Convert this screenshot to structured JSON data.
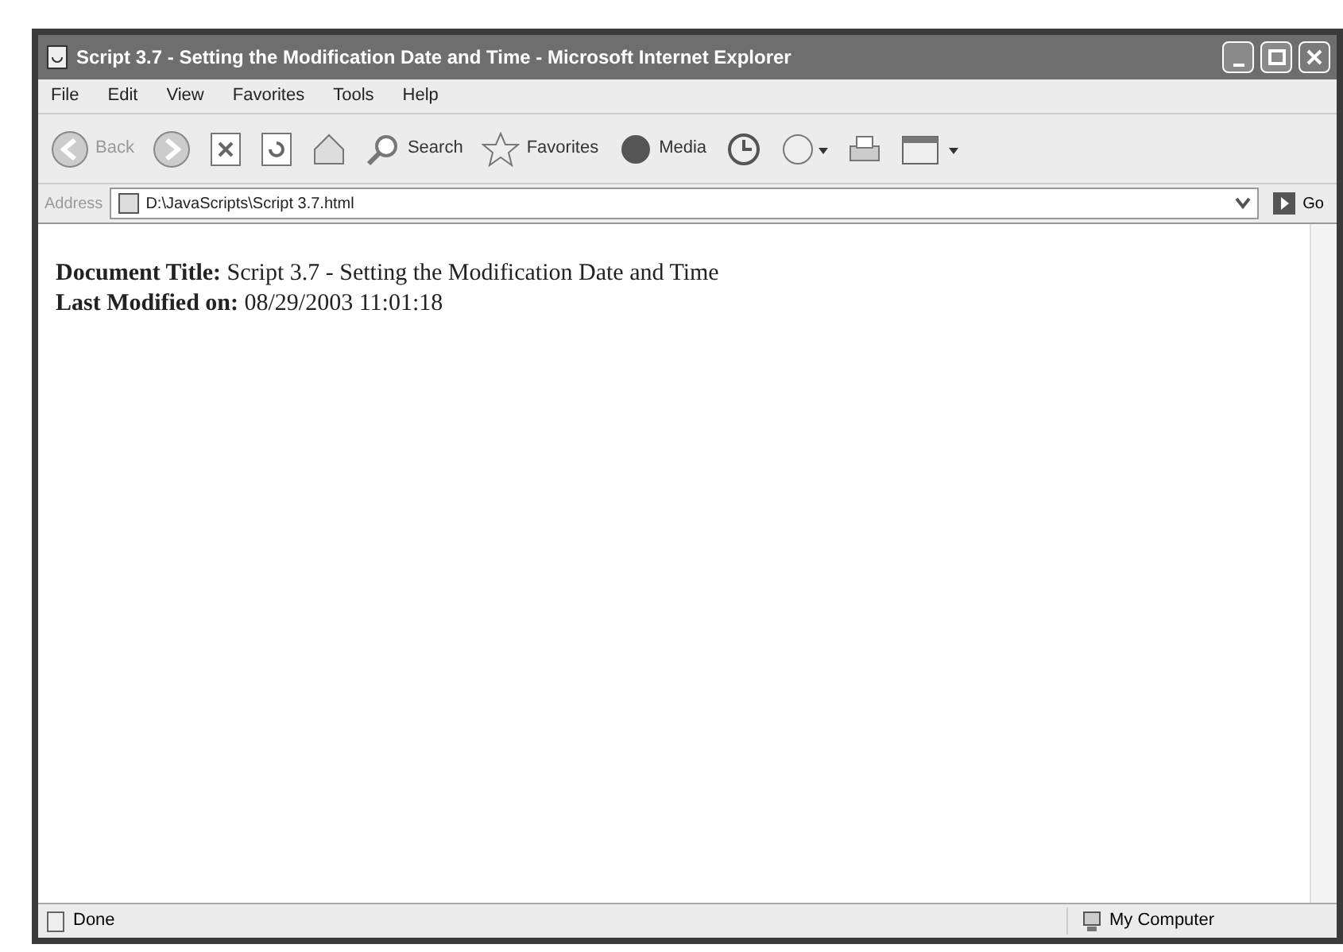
{
  "window": {
    "title": "Script 3.7 - Setting the Modification Date and Time - Microsoft Internet Explorer"
  },
  "menu": [
    "File",
    "Edit",
    "View",
    "Favorites",
    "Tools",
    "Help"
  ],
  "toolbar": {
    "back": "Back",
    "search": "Search",
    "favorites": "Favorites",
    "media": "Media"
  },
  "address_bar": {
    "label": "Address",
    "value": "D:\\JavaScripts\\Script 3.7.html",
    "go": "Go"
  },
  "content": [
    {
      "label": "Document Title:",
      "value": "Script 3.7 - Setting the Modification Date and Time"
    },
    {
      "label": "Last Modified on:",
      "value": "08/29/2003 11:01:18"
    }
  ],
  "status_bar": {
    "status": "Done",
    "zone": "My Computer"
  }
}
